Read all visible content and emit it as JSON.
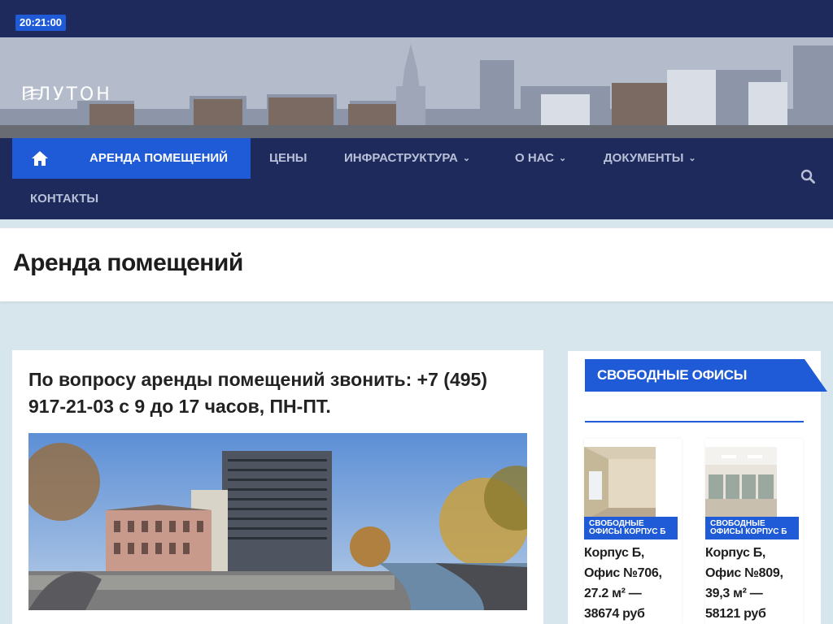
{
  "topbar": {
    "time": "20:21:00"
  },
  "brand": {
    "logo_text": "ПЛУТОН"
  },
  "nav": {
    "items": [
      {
        "label": "Аренда помещений",
        "active": true
      },
      {
        "label": "Цены"
      },
      {
        "label": "Инфраструктура",
        "dropdown": true
      },
      {
        "label": "О нас",
        "dropdown": true
      },
      {
        "label": "Документы",
        "dropdown": true
      },
      {
        "label": "Контакты"
      }
    ],
    "home_icon": "home-icon",
    "search_icon": "search-icon"
  },
  "page": {
    "title": "Аренда помещений"
  },
  "main": {
    "call_text": "По вопросу аренды помещений звонить: +7 (495) 917-21-03  с 9 до 17 часов, ПН-ПТ."
  },
  "sidebar": {
    "heading": "Свободные офисы",
    "offices": [
      {
        "badge": "Свободные офисы корпус Б",
        "text": "Корпус Б, Офис №706, 27.2 м² — 38674 руб"
      },
      {
        "badge": "Свободные офисы корпус Б",
        "text": "Корпус Б, Офис №809, 39,3 м² — 58121 руб"
      }
    ]
  },
  "colors": {
    "navy": "#1e2a5c",
    "accent": "#1f5bd6",
    "page_bg": "#d6e6ec"
  }
}
